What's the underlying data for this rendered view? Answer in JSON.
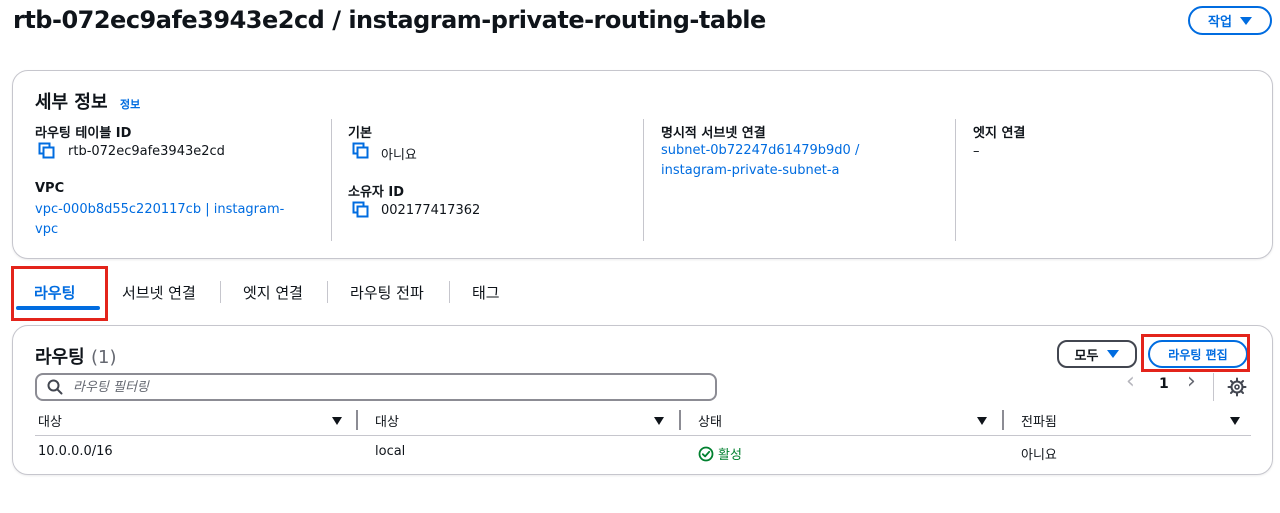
{
  "header": {
    "title": "rtb-072ec9afe3943e2cd / instagram-private-routing-table",
    "action_label": "작업"
  },
  "details": {
    "title": "세부 정보",
    "info_link": "정보",
    "route_table_id": {
      "label": "라우팅 테이블 ID",
      "value": "rtb-072ec9afe3943e2cd"
    },
    "vpc": {
      "label": "VPC",
      "value": "vpc-000b8d55c220117cb | instagram-vpc"
    },
    "main": {
      "label": "기본",
      "value": "아니요"
    },
    "owner_id": {
      "label": "소유자 ID",
      "value": "002177417362"
    },
    "explicit_subnet": {
      "label": "명시적 서브넷 연결",
      "value": "subnet-0b72247d61479b9d0 / instagram-private-subnet-a"
    },
    "edge": {
      "label": "엣지 연결",
      "value": "–"
    }
  },
  "tabs": [
    {
      "label": "라우팅"
    },
    {
      "label": "서브넷 연결"
    },
    {
      "label": "엣지 연결"
    },
    {
      "label": "라우팅 전파"
    },
    {
      "label": "태그"
    }
  ],
  "routes": {
    "title": "라우팅",
    "count": "(1)",
    "filter_select": "모두",
    "edit_button": "라우팅 편집",
    "search_placeholder": "라우팅 필터링",
    "pager": {
      "prev": "‹",
      "page": "1",
      "next": "›"
    },
    "columns": [
      "대상",
      "대상",
      "상태",
      "전파됨"
    ],
    "rows": [
      {
        "destination": "10.0.0.0/16",
        "target": "local",
        "status": "활성",
        "propagated": "아니요"
      }
    ]
  },
  "colors": {
    "accent": "#006ce0",
    "highlight": "#e3241b",
    "success": "#00802f"
  }
}
